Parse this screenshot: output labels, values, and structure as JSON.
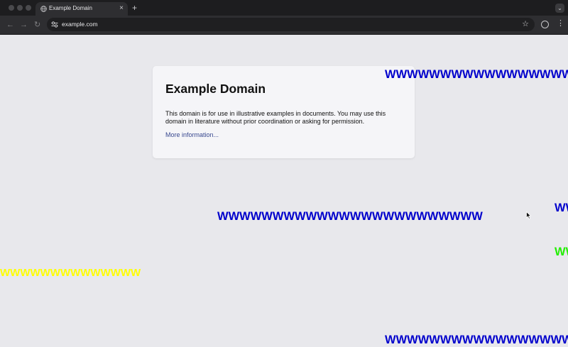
{
  "browser": {
    "tab": {
      "title": "Example Domain",
      "close_glyph": "×",
      "favicon": "globe-icon"
    },
    "new_tab_glyph": "+",
    "tab_search_glyph": "⌄",
    "nav": {
      "back_glyph": "←",
      "forward_glyph": "→",
      "reload_glyph": "↻"
    },
    "address_bar": {
      "url": "example.com",
      "site_info_icon": "tune-icon"
    },
    "bookmark_glyph": "☆",
    "menu_glyph": "⋮"
  },
  "page": {
    "heading": "Example Domain",
    "paragraph": "This domain is for use in illustrative examples in documents. You may use this domain in literature without prior coordination or asking for permission.",
    "link": "More information..."
  },
  "overlay_texts": [
    {
      "text": "WWWWWWWWWWWWWWWWW",
      "color": "#0000cc"
    },
    {
      "text": "WWWWWWWWWWWWWWWWWWWWWWWW",
      "color": "#0000cc"
    },
    {
      "text": "WW",
      "color": "#0000cc"
    },
    {
      "text": "WW",
      "color": "#22ee00"
    },
    {
      "text": "WWWWWWWWWWWWWW",
      "color": "#ffff00"
    },
    {
      "text": "WWWWWWWWWWWWWWWWW",
      "color": "#0000cc"
    }
  ],
  "colors": {
    "page_background": "#e8e8ec",
    "card_background": "#f5f5f8",
    "link": "#38488f",
    "chrome_dark": "#1d1d1f",
    "toolbar": "#2e2e31"
  }
}
